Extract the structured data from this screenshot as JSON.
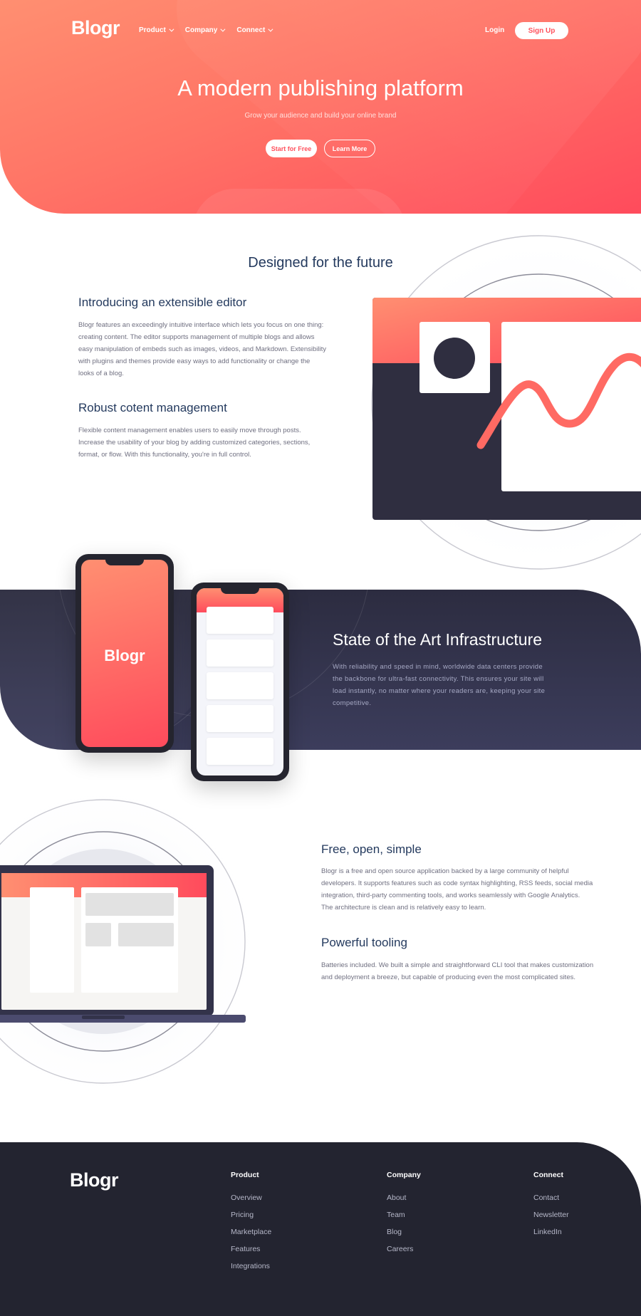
{
  "header": {
    "logo": "Blogr",
    "nav": [
      {
        "label": "Product"
      },
      {
        "label": "Company"
      },
      {
        "label": "Connect"
      }
    ],
    "login": "Login",
    "signup": "Sign Up"
  },
  "hero": {
    "title": "A modern publishing platform",
    "subtitle": "Grow your audience and build your online brand",
    "primary_cta": "Start for Free",
    "secondary_cta": "Learn More"
  },
  "designed": {
    "title": "Designed for the future",
    "features": [
      {
        "heading": "Introducing an extensible editor",
        "lines": [
          "Blogr features an exceedingly intuitive interface which lets you focus on one thing:",
          "creating content. The editor supports management of multiple blogs and allows",
          "easy manipulation of embeds such as images, videos, and Markdown. Extensibility",
          "with plugins and themes provide easy ways to add functionality or change the",
          "looks of a blog."
        ]
      },
      {
        "heading": "Robust cotent management",
        "lines": [
          "Flexible content management enables users to easily move through posts.",
          "Increase the usability of your blog by adding customized categories, sections,",
          "format, or flow. With this functionality, you're in full control."
        ]
      }
    ]
  },
  "infrastructure": {
    "phone_logo": "Blogr",
    "title": "State of the Art Infrastructure",
    "lines": [
      "With reliability and speed in mind, worldwide data centers provide",
      "the backbone for ultra-fast connectivity. This ensures your site will",
      "load instantly, no matter where your readers are, keeping your site",
      "competitive."
    ]
  },
  "free": {
    "features": [
      {
        "heading": "Free, open, simple",
        "lines": [
          "Blogr is a free and open source application backed by a large community of helpful",
          "developers. It supports features such as code syntax highlighting, RSS feeds, social media",
          "integration, third-party commenting tools, and works seamlessly with Google Analytics.",
          "The architecture is clean and is relatively easy to learn."
        ]
      },
      {
        "heading": "Powerful tooling",
        "lines": [
          "Batteries included. We built a simple and straightforward CLI tool that makes customization",
          "and deployment a breeze, but capable of producing even the most complicated sites."
        ]
      }
    ]
  },
  "footer": {
    "logo": "Blogr",
    "columns": [
      {
        "heading": "Product",
        "links": [
          "Overview",
          "Pricing",
          "Marketplace",
          "Features",
          "Integrations"
        ]
      },
      {
        "heading": "Company",
        "links": [
          "About",
          "Team",
          "Blog",
          "Careers"
        ]
      },
      {
        "heading": "Connect",
        "links": [
          "Contact",
          "Newsletter",
          "LinkedIn"
        ]
      }
    ]
  },
  "colors": {
    "accent": "#ff525d",
    "hero_start": "#ff8f71",
    "hero_end": "#ff3e54",
    "navy_heading": "#243a5e",
    "dark_section": "#2c2c40",
    "footer_bg": "#232430"
  }
}
